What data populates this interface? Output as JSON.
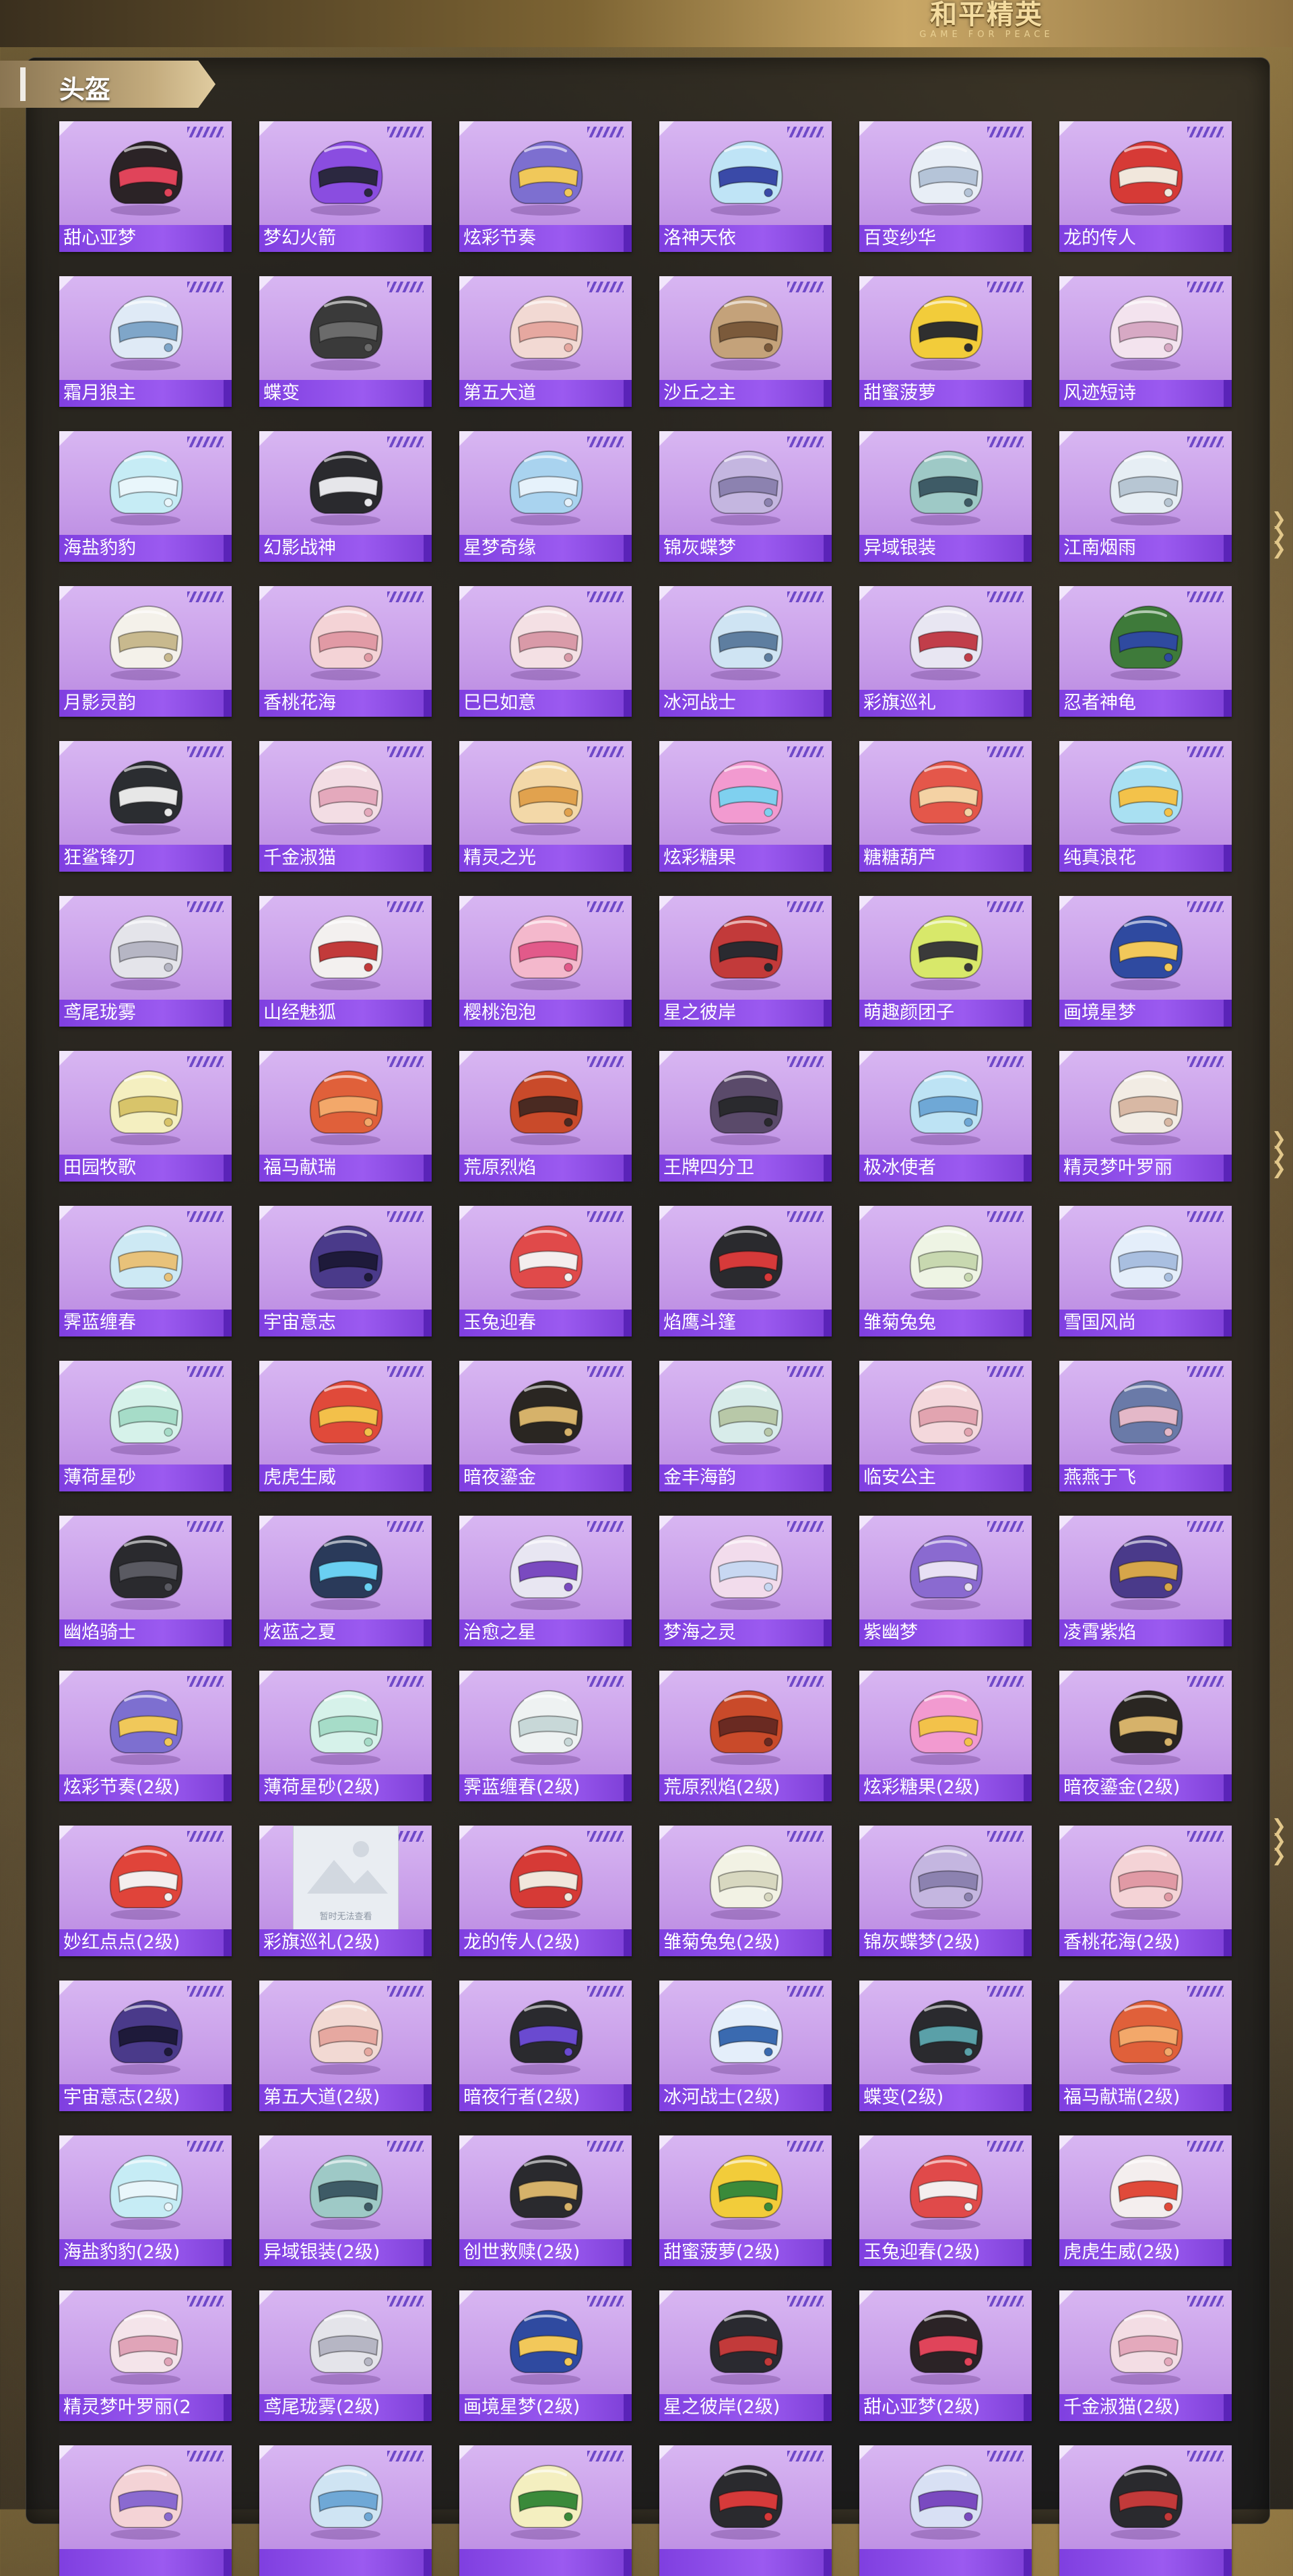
{
  "brand": {
    "logo_main": "和平精英",
    "logo_sub": "GAME FOR PEACE"
  },
  "section": {
    "title": "头盔"
  },
  "broken_image_text": "暂时无法查看",
  "items": [
    {
      "name": "甜心亚梦",
      "colors": [
        "#2b2326",
        "#e0445a"
      ]
    },
    {
      "name": "梦幻火箭",
      "colors": [
        "#8a4de0",
        "#2b2840"
      ]
    },
    {
      "name": "炫彩节奏",
      "colors": [
        "#7d6fd0",
        "#f0c85a"
      ]
    },
    {
      "name": "洛神天依",
      "colors": [
        "#bfe4f6",
        "#3a4aa8"
      ]
    },
    {
      "name": "百变纱华",
      "colors": [
        "#e8eef6",
        "#b5c4d8"
      ]
    },
    {
      "name": "龙的传人",
      "colors": [
        "#d63a36",
        "#f1e7dc"
      ]
    },
    {
      "name": "霜月狼主",
      "colors": [
        "#dfeaf6",
        "#7fa6c9"
      ]
    },
    {
      "name": "蝶变",
      "colors": [
        "#3a3a3a",
        "#6b6b6b"
      ]
    },
    {
      "name": "第五大道",
      "colors": [
        "#f2d9d3",
        "#e6a8a0"
      ]
    },
    {
      "name": "沙丘之主",
      "colors": [
        "#c4a27a",
        "#7b5a3b"
      ]
    },
    {
      "name": "甜蜜菠萝",
      "colors": [
        "#f2cc3a",
        "#2f2f2f"
      ]
    },
    {
      "name": "风迹短诗",
      "colors": [
        "#f3e3ee",
        "#d7a9c4"
      ]
    },
    {
      "name": "海盐豹豹",
      "colors": [
        "#c6ecf5",
        "#e9f6fb"
      ]
    },
    {
      "name": "幻影战神",
      "colors": [
        "#2a2a2e",
        "#e6e6ea"
      ]
    },
    {
      "name": "星梦奇缘",
      "colors": [
        "#a9d3ef",
        "#e6f2fb"
      ]
    },
    {
      "name": "锦灰蝶梦",
      "colors": [
        "#c4b6e0",
        "#8c82b0"
      ]
    },
    {
      "name": "异域银装",
      "colors": [
        "#9ec9c6",
        "#3e5b66"
      ]
    },
    {
      "name": "江南烟雨",
      "colors": [
        "#e6eef4",
        "#b7c6d3"
      ]
    },
    {
      "name": "月影灵韵",
      "colors": [
        "#f4f1ea",
        "#c8b98e"
      ]
    },
    {
      "name": "香桃花海",
      "colors": [
        "#f4d3d6",
        "#e19aa5"
      ]
    },
    {
      "name": "巳巳如意",
      "colors": [
        "#f4e0e4",
        "#d99aa8"
      ]
    },
    {
      "name": "冰河战士",
      "colors": [
        "#cfe4f3",
        "#5e7ea0"
      ]
    },
    {
      "name": "彩旗巡礼",
      "colors": [
        "#e8e6f2",
        "#c13e4a"
      ]
    },
    {
      "name": "忍者神龟",
      "colors": [
        "#3e7a3a",
        "#2f4aa0"
      ]
    },
    {
      "name": "狂鲨锋刃",
      "colors": [
        "#2b2d31",
        "#e7e7e7"
      ]
    },
    {
      "name": "千金淑猫",
      "colors": [
        "#f3dde4",
        "#e4a9bc"
      ]
    },
    {
      "name": "精灵之光",
      "colors": [
        "#f3d8a8",
        "#e1a24e"
      ]
    },
    {
      "name": "炫彩糖果",
      "colors": [
        "#f29ad0",
        "#7fd0ef"
      ]
    },
    {
      "name": "糖糖葫芦",
      "colors": [
        "#e4574a",
        "#f4d2a4"
      ]
    },
    {
      "name": "纯真浪花",
      "colors": [
        "#a9e0f2",
        "#f3c24a"
      ]
    },
    {
      "name": "鸢尾珑雾",
      "colors": [
        "#e4e4ea",
        "#b6b6c4"
      ]
    },
    {
      "name": "山经魅狐",
      "colors": [
        "#f3f0ef",
        "#c23a3a"
      ]
    },
    {
      "name": "樱桃泡泡",
      "colors": [
        "#f4b8cc",
        "#e25a8a"
      ]
    },
    {
      "name": "星之彼岸",
      "colors": [
        "#c23a3a",
        "#2a2a30"
      ]
    },
    {
      "name": "萌趣颜团子",
      "colors": [
        "#d8e86a",
        "#3a3a3a"
      ]
    },
    {
      "name": "画境星梦",
      "colors": [
        "#2f4aa0",
        "#f2c85a"
      ]
    },
    {
      "name": "田园牧歌",
      "colors": [
        "#f4efc0",
        "#d8c46a"
      ]
    },
    {
      "name": "福马献瑞",
      "colors": [
        "#e0603a",
        "#f3a86a"
      ]
    },
    {
      "name": "荒原烈焰",
      "colors": [
        "#c94a2a",
        "#4a2a22"
      ]
    },
    {
      "name": "王牌四分卫",
      "colors": [
        "#5a4a6a",
        "#2a2a2e"
      ]
    },
    {
      "name": "极冰使者",
      "colors": [
        "#bde3f4",
        "#6fa8d6"
      ]
    },
    {
      "name": "精灵梦叶罗丽",
      "colors": [
        "#f2ece4",
        "#d8b8a4"
      ]
    },
    {
      "name": "霁蓝缠春",
      "colors": [
        "#cde9f4",
        "#e8c27a"
      ]
    },
    {
      "name": "宇宙意志",
      "colors": [
        "#4a3a8a",
        "#1e1a3a"
      ]
    },
    {
      "name": "玉兔迎春",
      "colors": [
        "#e04a4a",
        "#f4eeee"
      ]
    },
    {
      "name": "焰鹰斗篷",
      "colors": [
        "#2a2a2e",
        "#d63a3a"
      ]
    },
    {
      "name": "雏菊兔兔",
      "colors": [
        "#eef4e4",
        "#c8d8b0"
      ]
    },
    {
      "name": "雪国风尚",
      "colors": [
        "#e4eefa",
        "#a9bfe0"
      ]
    },
    {
      "name": "薄荷星砂",
      "colors": [
        "#d6f2ea",
        "#a6dcc8"
      ]
    },
    {
      "name": "虎虎生威",
      "colors": [
        "#e04a3a",
        "#f3c04a"
      ]
    },
    {
      "name": "暗夜鎏金",
      "colors": [
        "#2a2622",
        "#d6b26a"
      ]
    },
    {
      "name": "金丰海韵",
      "colors": [
        "#d8ecea",
        "#b8c8a8"
      ]
    },
    {
      "name": "临安公主",
      "colors": [
        "#f4d8dc",
        "#e2a4b0"
      ]
    },
    {
      "name": "燕燕于飞",
      "colors": [
        "#6a7aa8",
        "#e4b8c8"
      ]
    },
    {
      "name": "幽焰骑士",
      "colors": [
        "#2a2a2e",
        "#5a5a62"
      ]
    },
    {
      "name": "炫蓝之夏",
      "colors": [
        "#2a3a5a",
        "#6ad0f2"
      ]
    },
    {
      "name": "治愈之星",
      "colors": [
        "#e8e6f2",
        "#7a4ac0"
      ]
    },
    {
      "name": "梦海之灵",
      "colors": [
        "#f2dcec",
        "#c8d8f2"
      ]
    },
    {
      "name": "紫幽梦",
      "colors": [
        "#8a6ad0",
        "#e8e0f4"
      ]
    },
    {
      "name": "凌霄紫焰",
      "colors": [
        "#4a3a8a",
        "#d6a64a"
      ]
    },
    {
      "name": "炫彩节奏(2级)",
      "colors": [
        "#7d6fd0",
        "#f0c85a"
      ]
    },
    {
      "name": "薄荷星砂(2级)",
      "colors": [
        "#d6f2ea",
        "#a6dcc8"
      ]
    },
    {
      "name": "霁蓝缠春(2级)",
      "colors": [
        "#eef2f2",
        "#c8d8d8"
      ]
    },
    {
      "name": "荒原烈焰(2级)",
      "colors": [
        "#c94a2a",
        "#6a2a22"
      ]
    },
    {
      "name": "炫彩糖果(2级)",
      "colors": [
        "#f29ad0",
        "#f3c24a"
      ]
    },
    {
      "name": "暗夜鎏金(2级)",
      "colors": [
        "#2a2622",
        "#d6b26a"
      ]
    },
    {
      "name": "妙红点点(2级)",
      "colors": [
        "#e0443a",
        "#f4eeee"
      ]
    },
    {
      "name": "彩旗巡礼(2级)",
      "colors": [
        "#e9edf2",
        "#c6cbd3"
      ],
      "broken": true
    },
    {
      "name": "龙的传人(2级)",
      "colors": [
        "#d63a36",
        "#f1e7dc"
      ]
    },
    {
      "name": "雏菊兔兔(2级)",
      "colors": [
        "#f2f2e4",
        "#d8d8c0"
      ]
    },
    {
      "name": "锦灰蝶梦(2级)",
      "colors": [
        "#c4b6e0",
        "#8c82b0"
      ]
    },
    {
      "name": "香桃花海(2级)",
      "colors": [
        "#f4d3d6",
        "#e19aa5"
      ]
    },
    {
      "name": "宇宙意志(2级)",
      "colors": [
        "#4a3a8a",
        "#1e1a3a"
      ]
    },
    {
      "name": "第五大道(2级)",
      "colors": [
        "#f2d9d3",
        "#e6a8a0"
      ]
    },
    {
      "name": "暗夜行者(2级)",
      "colors": [
        "#2a2a2e",
        "#6a4ad0"
      ]
    },
    {
      "name": "冰河战士(2级)",
      "colors": [
        "#e4eefa",
        "#3a6ab0"
      ]
    },
    {
      "name": "蝶变(2级)",
      "colors": [
        "#2a2a2e",
        "#5aa0a8"
      ]
    },
    {
      "name": "福马献瑞(2级)",
      "colors": [
        "#e0603a",
        "#f3a86a"
      ]
    },
    {
      "name": "海盐豹豹(2级)",
      "colors": [
        "#c6ecf5",
        "#e9f6fb"
      ]
    },
    {
      "name": "异域银装(2级)",
      "colors": [
        "#9ec9c6",
        "#3e5b66"
      ]
    },
    {
      "name": "创世救赎(2级)",
      "colors": [
        "#2a2a2e",
        "#d6b26a"
      ]
    },
    {
      "name": "甜蜜菠萝(2级)",
      "colors": [
        "#f2cc3a",
        "#3a8a3a"
      ]
    },
    {
      "name": "玉兔迎春(2级)",
      "colors": [
        "#e04a4a",
        "#f4eeee"
      ]
    },
    {
      "name": "虎虎生威(2级)",
      "colors": [
        "#f4eeee",
        "#e04a3a"
      ]
    },
    {
      "name": "精灵梦叶罗丽(2",
      "colors": [
        "#f4e4ea",
        "#e0a4b8"
      ]
    },
    {
      "name": "鸢尾珑雾(2级)",
      "colors": [
        "#e4e4ea",
        "#b6b6c4"
      ]
    },
    {
      "name": "画境星梦(2级)",
      "colors": [
        "#2f4aa0",
        "#f2c85a"
      ]
    },
    {
      "name": "星之彼岸(2级)",
      "colors": [
        "#2a2a30",
        "#c23a3a"
      ]
    },
    {
      "name": "甜心亚梦(2级)",
      "colors": [
        "#2b2326",
        "#e0445a"
      ]
    },
    {
      "name": "千金淑猫(2级)",
      "colors": [
        "#f3dde4",
        "#e4a9bc"
      ]
    },
    {
      "name": "",
      "colors": [
        "#f4d3d6",
        "#8a6ad0"
      ]
    },
    {
      "name": "",
      "colors": [
        "#cfe4f3",
        "#6fa8d6"
      ]
    },
    {
      "name": "",
      "colors": [
        "#f4efc0",
        "#3a8a3a"
      ]
    },
    {
      "name": "",
      "colors": [
        "#2a2a2e",
        "#d63a3a"
      ]
    },
    {
      "name": "",
      "colors": [
        "#d8e0f4",
        "#7a4ac0"
      ]
    },
    {
      "name": "",
      "colors": [
        "#2a2a2e",
        "#c23a3a"
      ]
    }
  ]
}
